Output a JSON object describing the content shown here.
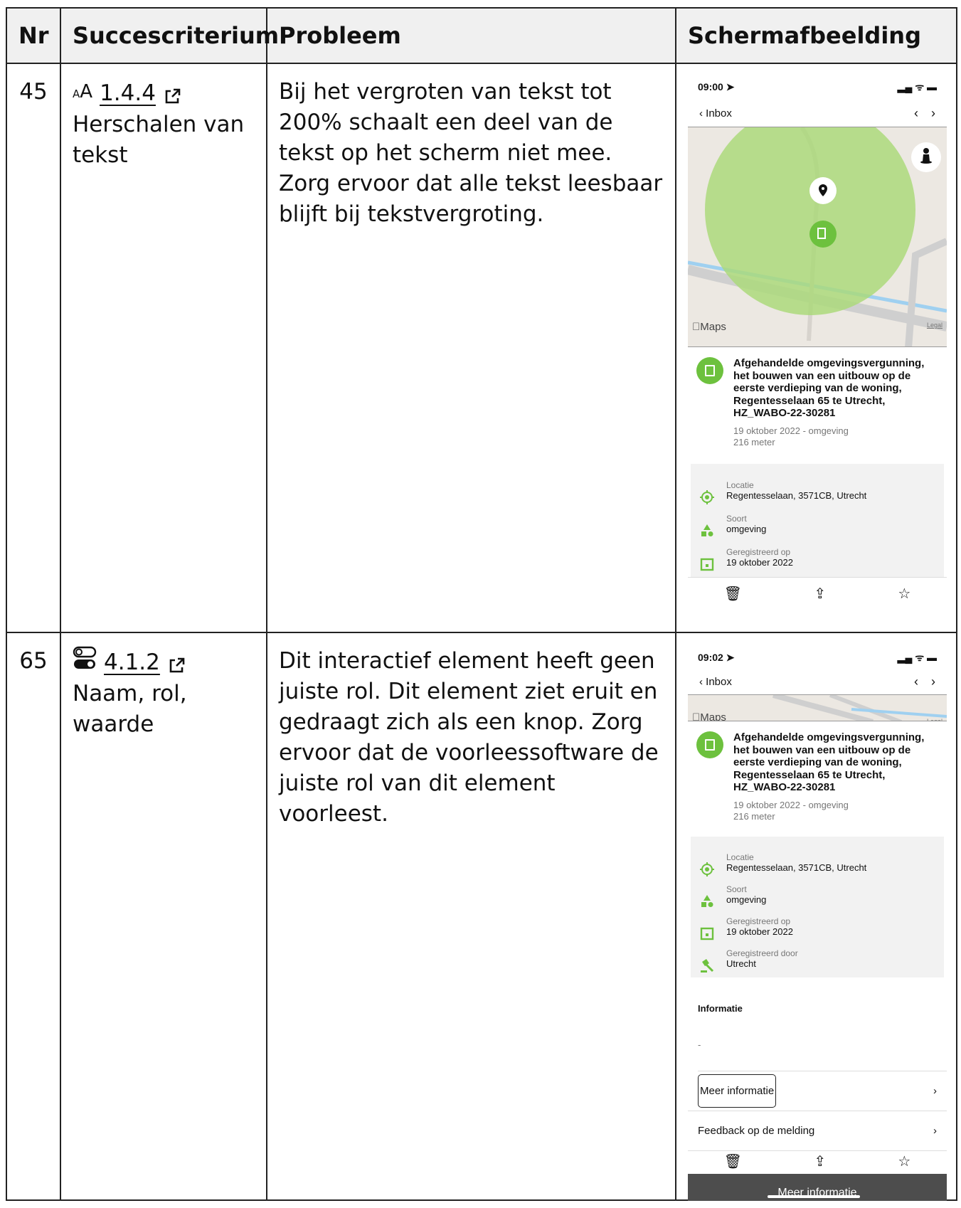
{
  "headers": {
    "nr": "Nr",
    "criterion": "Succescriterium",
    "problem": "Probleem",
    "screenshot": "Schermafbeelding"
  },
  "rows": [
    {
      "nr": "45",
      "criterion_icon": "text-resize-icon",
      "criterion_code": "1.4.4",
      "criterion_name": "Herschalen van tekst",
      "problem": "Bij het vergroten van tekst tot 200% schaalt een deel van de tekst op het scherm niet mee. Zorg ervoor dat alle tekst leesbaar blijft bij tekstvergroting.",
      "phone": {
        "time": "09:00",
        "back_label": "Inbox",
        "map_brand": "Maps",
        "map_legal": "Legal",
        "title": "Afgehandelde omgevingsvergunning, het bouwen van een uitbouw op de eerste verdieping van de woning, Regentesselaan 65 te Utrecht, HZ_WABO-22-30281",
        "date_line": "19 oktober 2022 - omgeving",
        "distance": "216 meter",
        "details": [
          {
            "icon": "location-target-icon",
            "label": "Locatie",
            "value": "Regentesselaan, 3571CB, Utrecht"
          },
          {
            "icon": "shapes-icon",
            "label": "Soort",
            "value": "omgeving"
          },
          {
            "icon": "calendar-icon",
            "label": "Geregistreerd op",
            "value": "19 oktober 2022"
          }
        ]
      }
    },
    {
      "nr": "65",
      "criterion_icon": "toggle-switch-icon",
      "criterion_code": "4.1.2",
      "criterion_name": "Naam, rol, waarde",
      "problem": "Dit interactief element heeft geen juiste rol. Dit element ziet eruit en gedraagt zich als een knop. Zorg ervoor dat de voorleessoftware de juiste rol van dit element voorleest.",
      "phone": {
        "time": "09:02",
        "back_label": "Inbox",
        "map_brand": "Maps",
        "map_legal": "Legal",
        "title": "Afgehandelde omgevingsvergunning, het bouwen van een uitbouw op de eerste verdieping van de woning, Regentesselaan 65 te Utrecht, HZ_WABO-22-30281",
        "date_line": "19 oktober 2022 - omgeving",
        "distance": "216 meter",
        "details": [
          {
            "icon": "location-target-icon",
            "label": "Locatie",
            "value": "Regentesselaan, 3571CB, Utrecht"
          },
          {
            "icon": "shapes-icon",
            "label": "Soort",
            "value": "omgeving"
          },
          {
            "icon": "calendar-icon",
            "label": "Geregistreerd op",
            "value": "19 oktober 2022"
          },
          {
            "icon": "gavel-icon",
            "label": "Geregistreerd door",
            "value": "Utrecht"
          }
        ],
        "info_title": "Informatie",
        "info_text": "-",
        "more_info": "Meer informatie",
        "feedback": "Feedback op de melding",
        "tooltip": "Meer informatie"
      }
    }
  ],
  "colors": {
    "accent_green": "#6dc13e",
    "header_bg": "#f0f0f0",
    "panel_bg": "#f2f2f2",
    "tooltip_bg": "#4d4d4d"
  }
}
